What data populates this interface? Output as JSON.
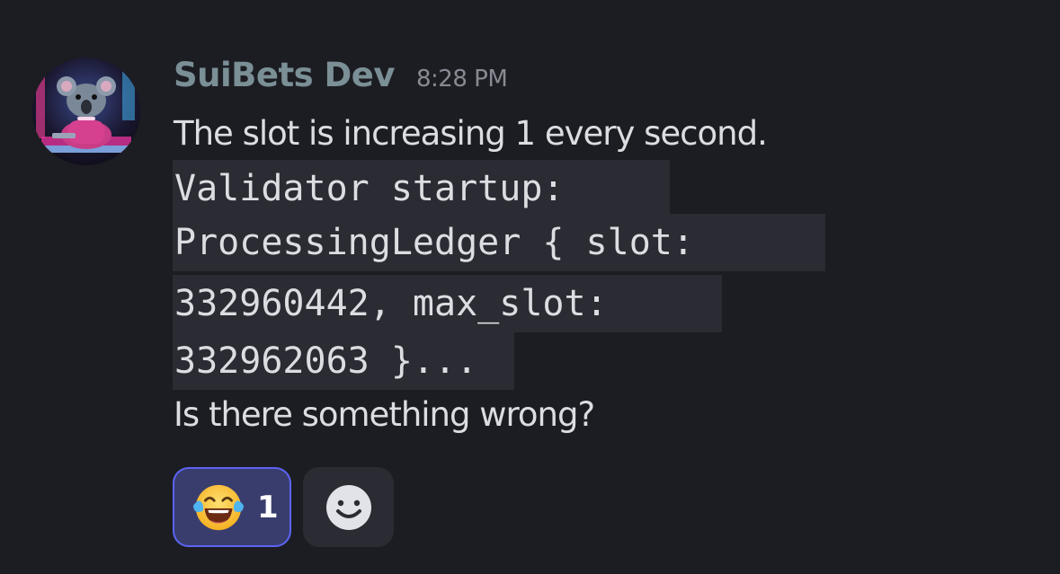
{
  "message": {
    "author": "SuiBets Dev",
    "timestamp": "8:28 PM",
    "text_before": "The slot is increasing 1 every second.",
    "code_lines": [
      "Validator startup: ",
      "ProcessingLedger { slot: ",
      "332960442, max_slot: ",
      "332962063 }..."
    ],
    "text_after": "Is there something wrong?",
    "avatar_icon": "koala-avatar-icon"
  },
  "reactions": [
    {
      "emoji_icon": "joy-emoji-icon",
      "count": "1",
      "selected": true
    }
  ],
  "add_reaction_icon": "smiley-face-icon",
  "colors": {
    "background": "#1c1d22",
    "username": "#7a8f96",
    "code_background": "#2a2b33",
    "reaction_background": "#393d6e",
    "reaction_border": "#5c64f4"
  }
}
